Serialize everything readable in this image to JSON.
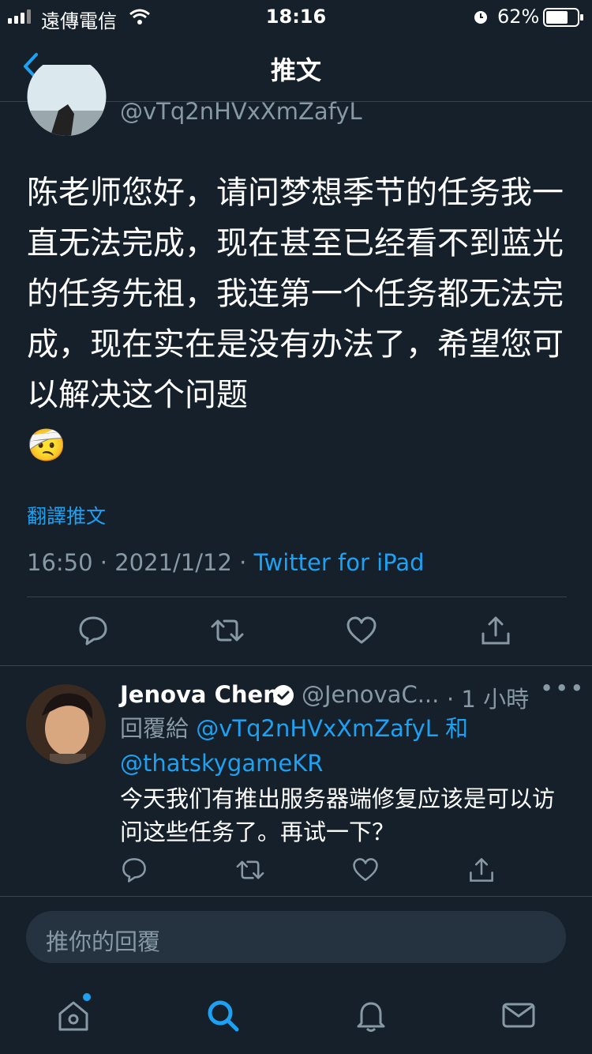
{
  "status_bar": {
    "carrier": "遠傳電信",
    "time": "18:16",
    "battery": "62%"
  },
  "nav": {
    "title": "推文"
  },
  "main_tweet": {
    "handle": "@vTq2nHVxXmZafyL",
    "text": "陈老师您好，请问梦想季节的任务我一直无法完成，现在甚至已经看不到蓝光的任务先祖，我连第一个任务都无法完成，现在实在是没有办法了，希望您可以解决这个问题",
    "emoji": "🤕",
    "translate_label": "翻譯推文",
    "time": "16:50",
    "separator": "·",
    "date": "2021/1/12",
    "source": "Twitter for iPad"
  },
  "reply": {
    "name": "Jenova Chen",
    "handle": "@JenovaC...",
    "time": "· 1 小時",
    "more": "•••",
    "reply_to_prefix": "回覆給",
    "reply_to_user1": "@vTq2nHVxXmZafyL",
    "reply_to_and": "和",
    "reply_to_user2": "@thatskygameKR",
    "text": "今天我们有推出服务器端修复应该是可以访问这些任务了。再试一下？"
  },
  "composer": {
    "placeholder": "推你的回覆"
  },
  "colors": {
    "background": "#15202b",
    "accent": "#1da1f2",
    "muted": "#8899a6",
    "divider": "#38444d"
  },
  "icons": [
    "back-chevron-icon",
    "reply-icon",
    "retweet-icon",
    "like-icon",
    "share-icon",
    "verified-badge-icon",
    "home-icon",
    "search-icon",
    "notifications-icon",
    "messages-icon"
  ]
}
